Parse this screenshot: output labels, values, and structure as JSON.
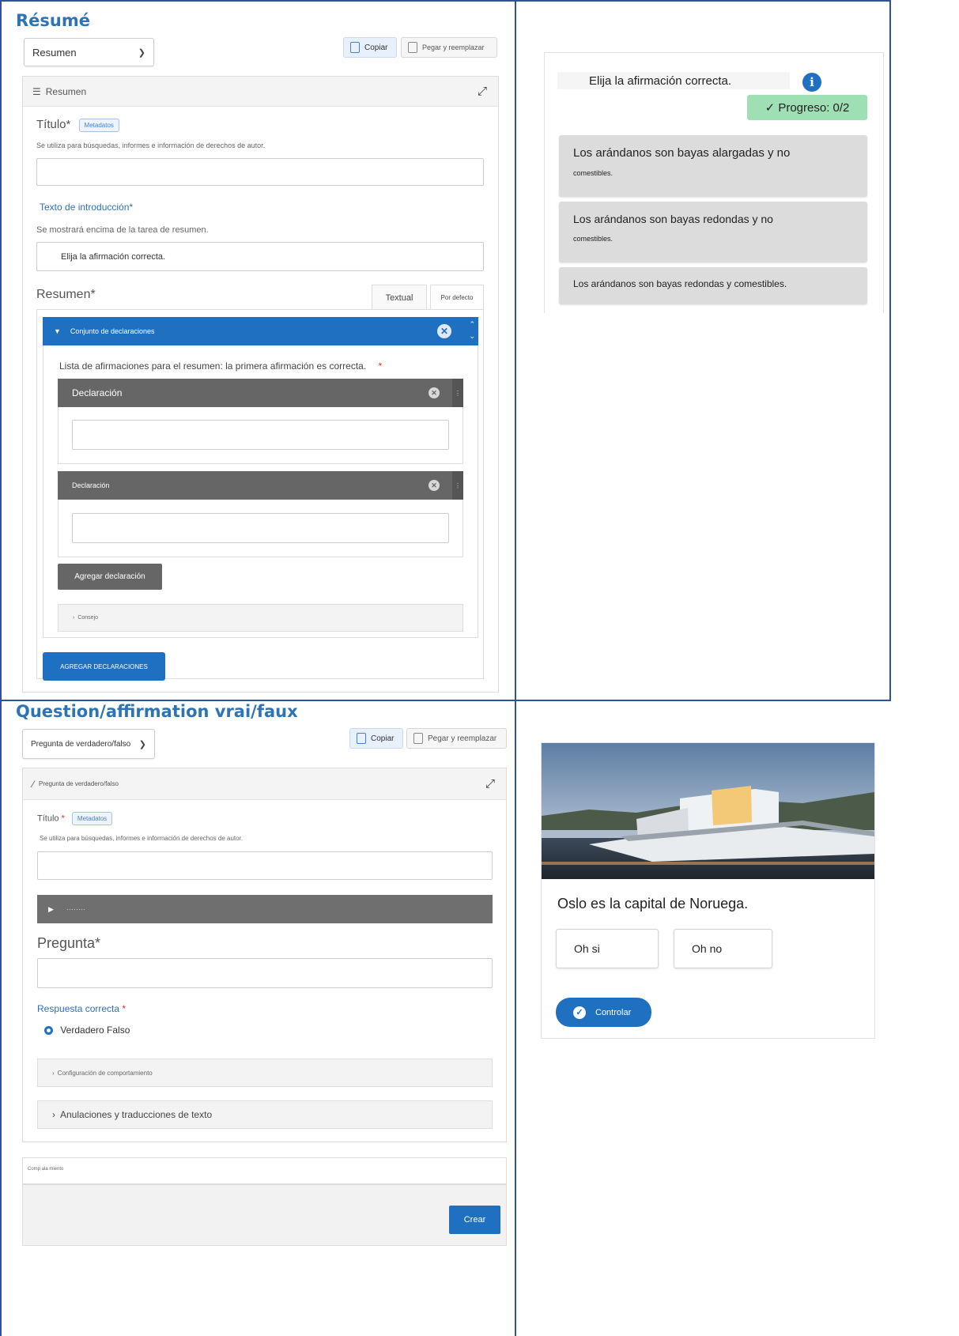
{
  "sections": {
    "resume_title": "Résumé",
    "truefalse_title": "Question/affirmation vrai/faux"
  },
  "summary_editor": {
    "content_type": "Resumen",
    "copy_label": "Copiar",
    "paste_label": "Pegar y reemplazar",
    "panel_title": "Resumen",
    "title_label": "Título*",
    "metadata_label": "Metadatos",
    "title_help": "Se utiliza para búsquedas, informes e información de derechos de autor.",
    "title_value": "",
    "intro_label": "Texto de introducción*",
    "intro_help": "Se mostrará encima de la tarea de resumen.",
    "intro_value": "Elija la afirmación correcta.",
    "summary_label": "Resumen*",
    "tab_textual": "Textual",
    "tab_default": "Por defecto",
    "group_label": "Conjunto de declaraciones",
    "list_label": "Lista de afirmaciones para el resumen: la primera afirmación es correcta.",
    "statements": [
      {
        "label": "Declaración",
        "value": ""
      },
      {
        "label": "Declaración",
        "value": ""
      }
    ],
    "add_statement": "Agregar declaración",
    "tip_label": "Consejo",
    "add_statements_upper": "AGREGAR DECLARACIONES"
  },
  "summary_preview": {
    "intro": "Elija la afirmación correcta.",
    "progress": "✓ Progreso: 0/2",
    "answers": [
      {
        "line1": "Los arándanos son bayas alargadas y no",
        "line2": "comestibles."
      },
      {
        "line1": "Los arándanos son bayas redondas y no",
        "line2": "comestibles."
      },
      {
        "line1": "Los arándanos son bayas redondas y comestibles.",
        "line2": ""
      }
    ]
  },
  "tf_editor": {
    "content_type": "Pregunta de verdadero/falso",
    "copy_label": "Copiar",
    "paste_label": "Pegar y reemplazar",
    "panel_title": "Pregunta de verdadero/falso",
    "title_label": "Título",
    "metadata_label": "Metadatos",
    "title_help": "Se utiliza para búsquedas, informes e información de derechos de autor.",
    "media_label": "········",
    "question_label": "Pregunta*",
    "correct_label": "Respuesta correcta",
    "radio_label": "Verdadero Falso",
    "behaviour_label": "Configuración de comportamiento",
    "overrides_label": "Anulaciones y traducciones de texto",
    "footer_label": "Comp ala miento",
    "create_label": "Crear"
  },
  "tf_preview": {
    "question": "Oslo es la capital de Noruega.",
    "true_label": "Oh si",
    "false_label": "Oh no",
    "check_label": "Controlar"
  },
  "colors": {
    "accent": "#1f70c1",
    "heading": "#2e74b5",
    "progress": "#9fdfb4",
    "statement_bar": "#666666"
  },
  "icons": {
    "list": "list-icon",
    "expand": "expand-icon",
    "info": "info-icon",
    "check": "check-icon",
    "close": "close-circle-icon"
  }
}
